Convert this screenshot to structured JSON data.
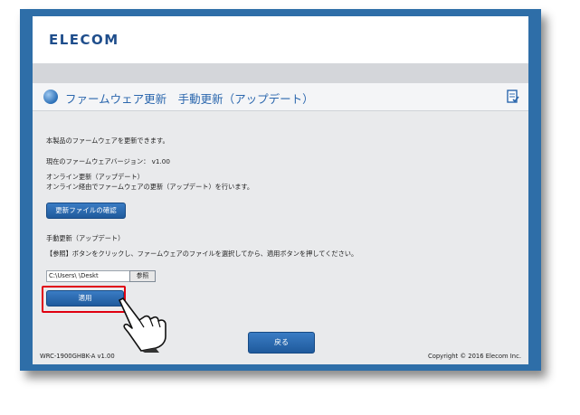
{
  "brand": {
    "logo": "ELECOM"
  },
  "page": {
    "title": "ファームウェア更新　手動更新（アップデート）"
  },
  "content": {
    "intro": "本製品のファームウェアを更新できます。",
    "current_version": "現在のファームウェアバージョン： v1.00",
    "online_heading": "オンライン更新（アップデート）",
    "online_desc": "オンライン経由でファームウェアの更新（アップデート）を行います。",
    "check_button": "更新ファイルの確認",
    "manual_heading": "手動更新（アップデート）",
    "manual_desc": "【参照】ボタンをクリックし、ファームウェアのファイルを選択してから、適用ボタンを押してください。",
    "file_path": "C:\\Users\\            \\Deskt",
    "browse_button": "参照",
    "apply_button": "適用",
    "back_button": "戻る"
  },
  "footer": {
    "model": "WRC-1900GHBK-A v1.00",
    "copyright": "Copyright © 2016 Elecom Inc."
  },
  "colors": {
    "frame": "#2e6ea8",
    "accent": "#2a66ad",
    "highlight": "#e00010"
  }
}
